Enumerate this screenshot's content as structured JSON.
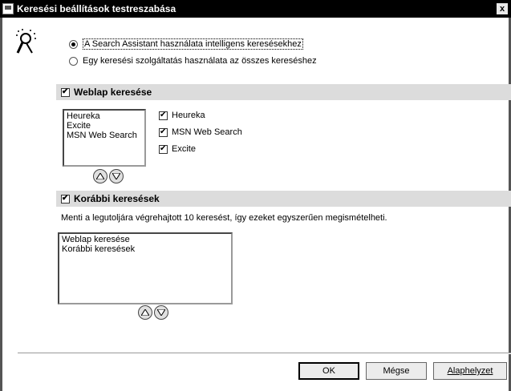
{
  "window": {
    "title": "Keresési beállítások testreszabása",
    "close_glyph": "x"
  },
  "mode": {
    "options": [
      {
        "label": "A Search Assistant használata intelligens keresésekhez",
        "selected": true
      },
      {
        "label": "Egy keresési szolgáltatás használata az összes kereséshez",
        "selected": false
      }
    ]
  },
  "web_search": {
    "title": "Weblap keresése",
    "checked": true,
    "list_items": [
      "Heureka",
      "Excite",
      "MSN Web Search"
    ],
    "providers": [
      {
        "label": "Heureka",
        "checked": true
      },
      {
        "label": "MSN Web Search",
        "checked": true
      },
      {
        "label": "Excite",
        "checked": true
      }
    ]
  },
  "previous": {
    "title": "Korábbi keresések",
    "checked": true,
    "description": "Menti a legutoljára végrehajtott 10 keresést, így ezeket egyszerűen megismételheti.",
    "list_items": [
      "Weblap keresése",
      "Korábbi keresések"
    ]
  },
  "buttons": {
    "ok": "OK",
    "cancel": "Mégse",
    "reset": "Alaphelyzet"
  },
  "icons": {
    "app": "search-window-icon",
    "assistant": "magic-wand-icon",
    "up": "arrow-up-icon",
    "down": "arrow-down-icon"
  }
}
